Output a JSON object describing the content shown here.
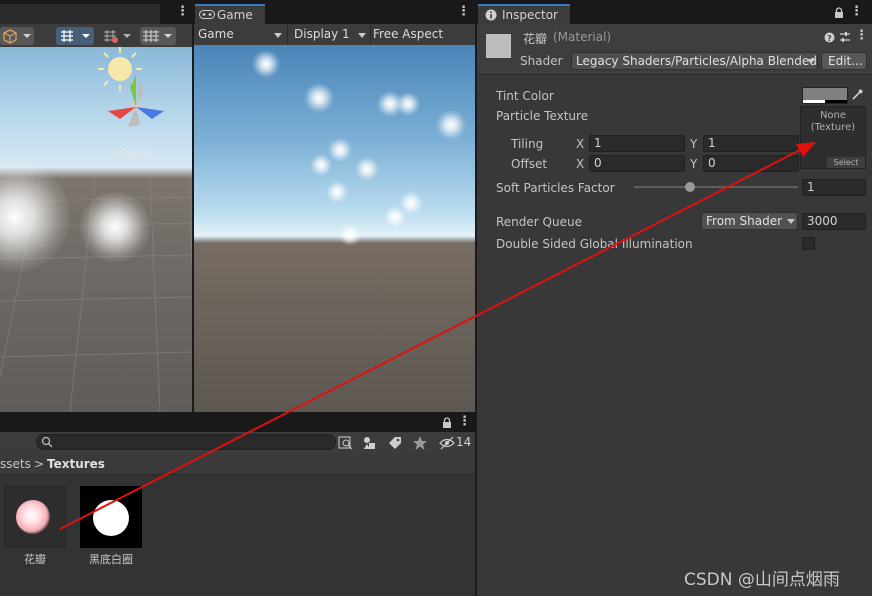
{
  "scene": {
    "persp_label": "<Persp"
  },
  "game": {
    "tab_label": "Game",
    "mode_dropdown": "Game",
    "display_dropdown": "Display 1",
    "aspect_dropdown": "Free Aspect"
  },
  "inspector": {
    "tab_label": "Inspector",
    "material_name": "花瓣",
    "material_type": "(Material)",
    "shader_label": "Shader",
    "shader_value": "Legacy Shaders/Particles/Alpha Blended",
    "edit_button": "Edit...",
    "tint_color_label": "Tint Color",
    "particle_texture_label": "Particle Texture",
    "tiling_label": "Tiling",
    "offset_label": "Offset",
    "x_label": "X",
    "y_label": "Y",
    "tiling_x": "1",
    "tiling_y": "1",
    "offset_x": "0",
    "offset_y": "0",
    "texture_slot_text_1": "None",
    "texture_slot_text_2": "(Texture)",
    "texture_select": "Select",
    "soft_particles_label": "Soft Particles Factor",
    "soft_particles_value": "1",
    "soft_particles_fraction": 0.33,
    "render_queue_label": "Render Queue",
    "render_queue_dropdown": "From Shader",
    "render_queue_value": "3000",
    "double_sided_label": "Double Sided Global Illumination"
  },
  "project": {
    "breadcrumb_prefix": "ssets",
    "breadcrumb_sep": ">",
    "breadcrumb_current": "Textures",
    "hidden_count": "14",
    "assets": [
      {
        "name": "花瓣"
      },
      {
        "name": "黑底白圈"
      }
    ]
  },
  "watermark": "CSDN @山间点烟雨",
  "colors": {
    "accent_tab": "#3a79bb",
    "panel_bg": "#383838",
    "annotation_arrow": "#e01010"
  }
}
